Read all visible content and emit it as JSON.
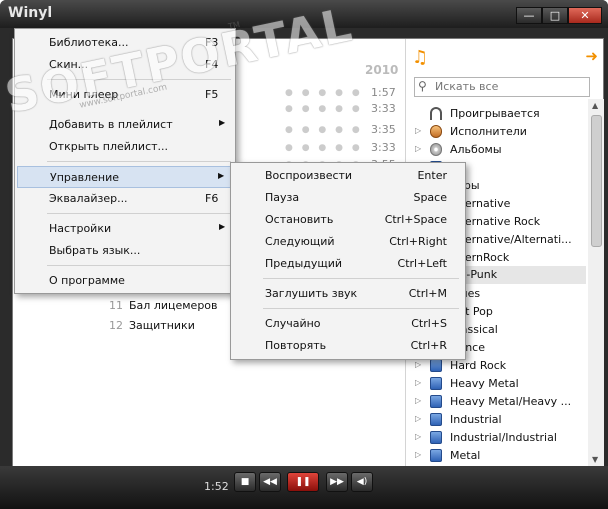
{
  "app": {
    "title": "Winyl"
  },
  "window_buttons": {
    "minimize": "—",
    "maximize": "□",
    "close": "✕"
  },
  "playlist": {
    "year": "2010",
    "rows": [
      {
        "num": "",
        "title": "",
        "duration": "1:57"
      },
      {
        "num": "",
        "title": "",
        "duration": "3:33"
      },
      {
        "num": "",
        "title": "",
        "duration": "3:35"
      },
      {
        "num": "",
        "title": "",
        "duration": "3:33"
      },
      {
        "num": "",
        "title": "ия",
        "duration": "3:55"
      },
      {
        "num": "11",
        "title": "Бал лицемеров",
        "duration": ""
      },
      {
        "num": "12",
        "title": "Защитники",
        "duration": ""
      }
    ]
  },
  "right_panel": {
    "search_placeholder": "Искать все",
    "tree": [
      {
        "label": "Проигрывается",
        "icon": "headphones-icon",
        "toggle": ""
      },
      {
        "label": "Исполнители",
        "icon": "user-icon",
        "toggle": "▷"
      },
      {
        "label": "Альбомы",
        "icon": "disc-icon",
        "toggle": "▷"
      },
      {
        "label": "ы",
        "icon": "genre-icon",
        "toggle": "▷"
      },
      {
        "label": "анры",
        "icon": "genre-icon",
        "toggle": "▷"
      },
      {
        "label": "Alternative",
        "icon": "genre-icon",
        "toggle": "▷"
      },
      {
        "label": "Alternative Rock",
        "icon": "genre-icon",
        "toggle": "▷"
      },
      {
        "label": "Alternative/Alternati...",
        "icon": "genre-icon",
        "toggle": "▷"
      },
      {
        "label": "AlternRock",
        "icon": "genre-icon",
        "toggle": "▷"
      },
      {
        "label": "Art-Punk",
        "icon": "genre-icon",
        "toggle": "▷"
      },
      {
        "label": "Blues",
        "icon": "genre-icon",
        "toggle": "▷"
      },
      {
        "label": "Brit Pop",
        "icon": "genre-icon",
        "toggle": "▷"
      },
      {
        "label": "Classical",
        "icon": "genre-icon",
        "toggle": "▷"
      },
      {
        "label": "Dance",
        "icon": "genre-icon",
        "toggle": "▷"
      },
      {
        "label": "Hard Rock",
        "icon": "genre-icon",
        "toggle": "▷"
      },
      {
        "label": "Heavy Metal",
        "icon": "genre-icon",
        "toggle": "▷"
      },
      {
        "label": "Heavy Metal/Heavy ...",
        "icon": "genre-icon",
        "toggle": "▷"
      },
      {
        "label": "Industrial",
        "icon": "genre-icon",
        "toggle": "▷"
      },
      {
        "label": "Industrial/Industrial",
        "icon": "genre-icon",
        "toggle": "▷"
      },
      {
        "label": "Metal",
        "icon": "genre-icon",
        "toggle": "▷"
      }
    ]
  },
  "main_menu": [
    {
      "label": "Библиотека...",
      "shortcut": "F3",
      "submenu": false
    },
    {
      "label": "Скин...",
      "shortcut": "F4",
      "submenu": false
    },
    {
      "label": "Мини плеер",
      "shortcut": "F5",
      "submenu": false
    },
    {
      "label": "Добавить в плейлист",
      "shortcut": "",
      "submenu": true
    },
    {
      "label": "Открыть плейлист...",
      "shortcut": "",
      "submenu": false
    },
    {
      "label": "Управление",
      "shortcut": "",
      "submenu": true
    },
    {
      "label": "Эквалайзер...",
      "shortcut": "F6",
      "submenu": false
    },
    {
      "label": "Настройки",
      "shortcut": "",
      "submenu": true
    },
    {
      "label": "Выбрать язык...",
      "shortcut": "",
      "submenu": false
    },
    {
      "label": "О программе",
      "shortcut": "",
      "submenu": false
    }
  ],
  "control_menu": [
    {
      "label": "Воспроизвести",
      "shortcut": "Enter"
    },
    {
      "label": "Пауза",
      "shortcut": "Space"
    },
    {
      "label": "Остановить",
      "shortcut": "Ctrl+Space"
    },
    {
      "label": "Следующий",
      "shortcut": "Ctrl+Right"
    },
    {
      "label": "Предыдущий",
      "shortcut": "Ctrl+Left"
    },
    {
      "label": "Заглушить звук",
      "shortcut": "Ctrl+M"
    },
    {
      "label": "Случайно",
      "shortcut": "Ctrl+S"
    },
    {
      "label": "Повторять",
      "shortcut": "Ctrl+R"
    }
  ],
  "transport": {
    "time": "1:52"
  },
  "watermark": {
    "text": "SOFTPORTAL",
    "url": "www.softportal.com",
    "tm": "TM"
  },
  "colors": {
    "accent": "#f29000",
    "play": "#d0302a",
    "highlight": "#d7e3f2"
  }
}
